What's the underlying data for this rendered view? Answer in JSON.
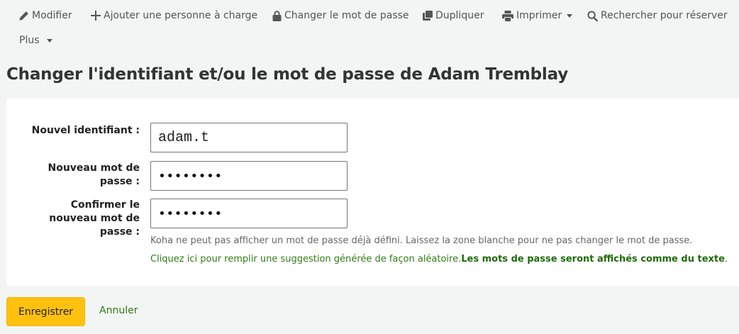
{
  "toolbar": {
    "edit": "Modifier",
    "add_guarantee": "Ajouter une personne à charge",
    "change_password": "Changer le mot de passe",
    "duplicate": "Dupliquer",
    "print": "Imprimer",
    "search_to_hold": "Rechercher pour réserver",
    "more": "Plus"
  },
  "page": {
    "title": "Changer l'identifiant et/ou le mot de passe de Adam Tremblay"
  },
  "form": {
    "userid_label": "Nouvel identifiant :",
    "userid_value": "adam.t",
    "password_label": "Nouveau mot de passe :",
    "password_value": "••••••••",
    "confirm_label": "Confirmer le nouveau mot de passe :",
    "confirm_value": "••••••••",
    "hint": "Koha ne peut pas afficher un mot de passe déjà défini. Laissez la zone blanche pour ne pas changer le mot de passe.",
    "suggest_text": "Cliquez ici pour remplir une suggestion générée de façon aléatoire.",
    "suggest_bold": "Les mots de passe seront affichés comme du texte",
    "suggest_end": "."
  },
  "actions": {
    "save": "Enregistrer",
    "cancel": "Annuler"
  },
  "colors": {
    "background": "#f3f4f4",
    "save_button": "#ffc10e",
    "link_green": "#2f7d14"
  }
}
